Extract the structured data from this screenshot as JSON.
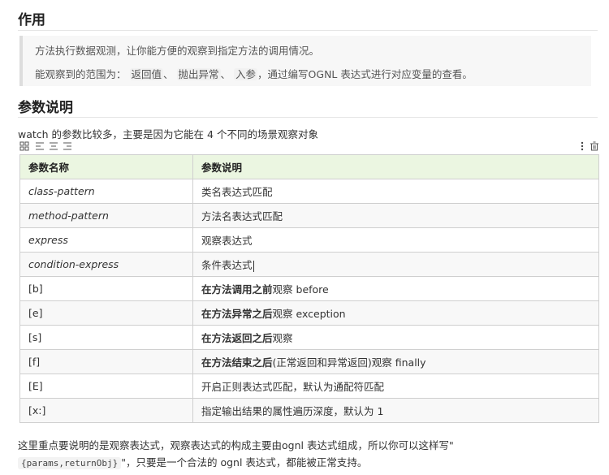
{
  "section1": {
    "title": "作用",
    "quote_line1": "方法执行数据观测，让你能方便的观察到指定方法的调用情况。",
    "quote_line2_prefix": "能观察到的范围为：",
    "quote_tags": [
      "返回值",
      "抛出异常",
      "入参"
    ],
    "quote_sep": "、",
    "quote_line2_suffix": "，通过编写OGNL 表达式进行对应变量的查看。"
  },
  "section2": {
    "title": "参数说明",
    "intro": "watch 的参数比较多，主要是因为它能在 4 个不同的场景观察对象"
  },
  "toolbar": {
    "icons": [
      "grid-icon",
      "align-left-icon",
      "align-center-icon",
      "align-right-icon",
      "more-icon",
      "trash-icon"
    ]
  },
  "table": {
    "headers": [
      "参数名称",
      "参数说明"
    ],
    "rows": [
      {
        "name": "class-pattern",
        "italic": true,
        "parts": [
          {
            "t": "类名表达式匹配",
            "b": false
          }
        ]
      },
      {
        "name": "method-pattern",
        "italic": true,
        "parts": [
          {
            "t": "方法名表达式匹配",
            "b": false
          }
        ]
      },
      {
        "name": "express",
        "italic": true,
        "parts": [
          {
            "t": "观察表达式",
            "b": false
          }
        ]
      },
      {
        "name": "condition-express",
        "italic": true,
        "parts": [
          {
            "t": "条件表达式",
            "b": false
          }
        ],
        "cursor": true
      },
      {
        "name": "[b]",
        "italic": false,
        "parts": [
          {
            "t": "在",
            "b": true
          },
          {
            "t": "方法调用之前",
            "b": true
          },
          {
            "t": "观察 before",
            "b": false
          }
        ]
      },
      {
        "name": "[e]",
        "italic": false,
        "parts": [
          {
            "t": "在",
            "b": true
          },
          {
            "t": "方法异常之后",
            "b": true
          },
          {
            "t": "观察 exception",
            "b": false
          }
        ]
      },
      {
        "name": "[s]",
        "italic": false,
        "parts": [
          {
            "t": "在",
            "b": true
          },
          {
            "t": "方法返回之后",
            "b": true
          },
          {
            "t": "观察",
            "b": false
          }
        ]
      },
      {
        "name": "[f]",
        "italic": false,
        "parts": [
          {
            "t": "在",
            "b": true
          },
          {
            "t": "方法结束之后",
            "b": true
          },
          {
            "t": "(正常返回和异常返回)观察  finally",
            "b": false
          }
        ]
      },
      {
        "name": "[E]",
        "italic": false,
        "parts": [
          {
            "t": "开启正则表达式匹配，默认为通配符匹配",
            "b": false
          }
        ]
      },
      {
        "name": "[x:]",
        "italic": false,
        "parts": [
          {
            "t": "指定输出结果的属性遍历深度，默认为 1",
            "b": false
          }
        ]
      }
    ]
  },
  "footer": {
    "line1": "这里重点要说明的是观察表达式，观察表达式的构成主要由ognl 表达式组成，所以你可以这样写\"",
    "code": "{params,returnObj}",
    "line2_suffix": "\"，只要是一个合法的 ognl 表达式，都能被正常支持。"
  }
}
